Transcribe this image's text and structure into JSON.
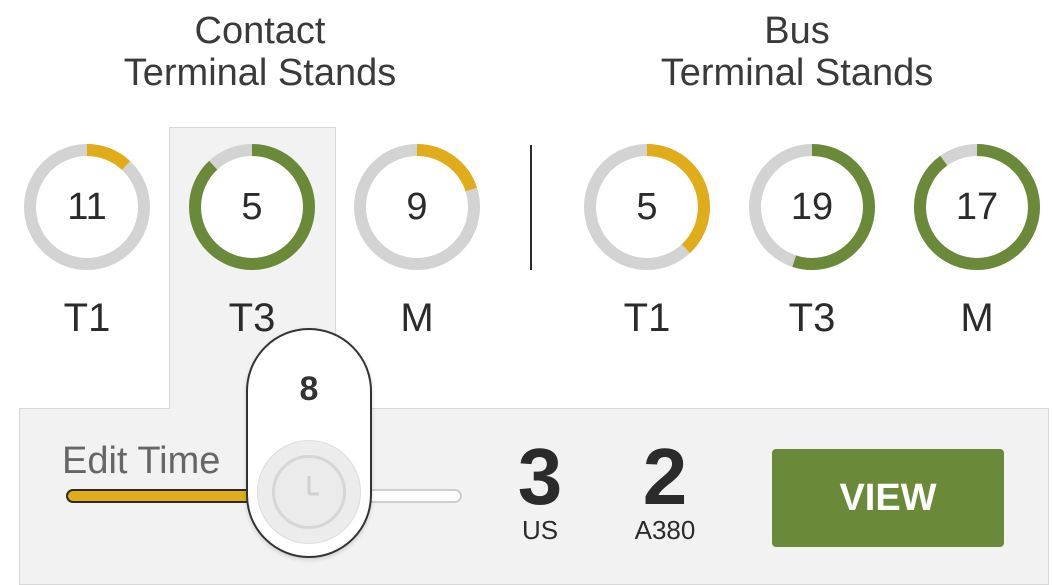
{
  "groups": {
    "contact": {
      "title_line1": "Contact",
      "title_line2": "Terminal Stands"
    },
    "bus": {
      "title_line1": "Bus",
      "title_line2": "Terminal Stands"
    }
  },
  "stands": {
    "contact": [
      {
        "label": "T1",
        "value": "11",
        "fraction": 0.12,
        "color": "#e0ac1a",
        "selected": false
      },
      {
        "label": "T3",
        "value": "5",
        "fraction": 0.88,
        "color": "#6a8a3a",
        "selected": true
      },
      {
        "label": "M",
        "value": "9",
        "fraction": 0.2,
        "color": "#e0ac1a",
        "selected": false
      }
    ],
    "bus": [
      {
        "label": "T1",
        "value": "5",
        "fraction": 0.38,
        "color": "#e0ac1a",
        "selected": false
      },
      {
        "label": "T3",
        "value": "19",
        "fraction": 0.55,
        "color": "#6a8a3a",
        "selected": false
      },
      {
        "label": "M",
        "value": "17",
        "fraction": 0.9,
        "color": "#6a8a3a",
        "selected": false
      }
    ]
  },
  "edit_time": {
    "label": "Edit Time",
    "value": "8",
    "fill_fraction": 0.6,
    "icon": "clock-icon"
  },
  "stats": {
    "us": {
      "value": "3",
      "label": "US"
    },
    "a380": {
      "value": "2",
      "label": "A380"
    }
  },
  "view_button": {
    "label": "VIEW"
  },
  "colors": {
    "accent_green": "#6a8a3a",
    "accent_yellow": "#e0ac1a",
    "ring_track": "#d3d3d3",
    "panel_bg": "#f2f2f2"
  }
}
